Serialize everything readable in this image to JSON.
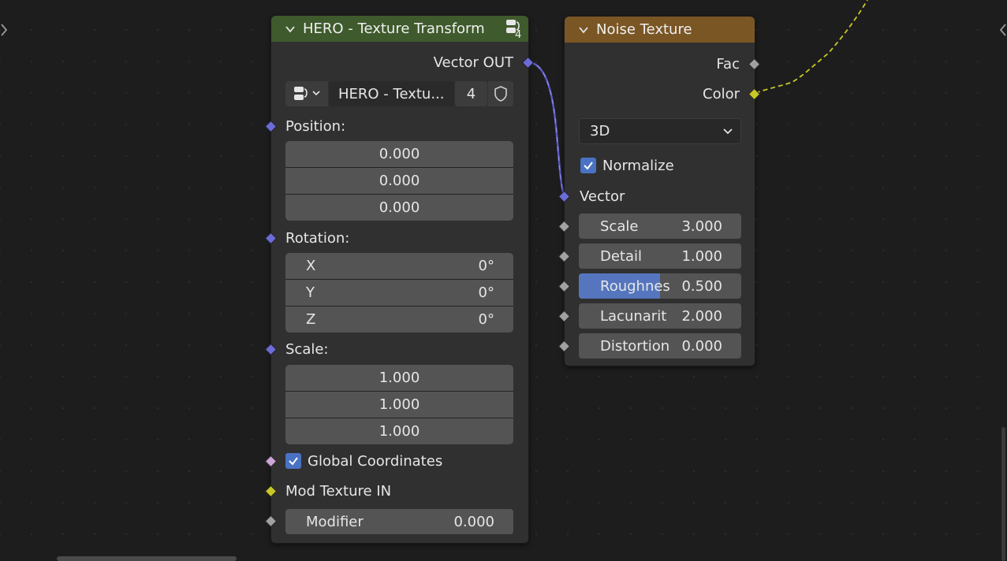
{
  "colors": {
    "header_transform": "#3f5a2c",
    "header_noise": "#7a5625",
    "socket_vector": "#6c6cd6",
    "socket_color": "#c7c729",
    "socket_float": "#a1a1a1",
    "socket_bool": "#cca6d6",
    "checkbox": "#4a72c4"
  },
  "group_node": {
    "title": "HERO - Texture Transform",
    "user_count": "4",
    "output_label": "Vector OUT",
    "datablock": {
      "name": "HERO - Textu...",
      "users": "4"
    },
    "position": {
      "label": "Position:",
      "values": [
        "0.000",
        "0.000",
        "0.000"
      ]
    },
    "rotation": {
      "label": "Rotation:",
      "axes": [
        {
          "axis": "X",
          "value": "0°"
        },
        {
          "axis": "Y",
          "value": "0°"
        },
        {
          "axis": "Z",
          "value": "0°"
        }
      ]
    },
    "scale": {
      "label": "Scale:",
      "values": [
        "1.000",
        "1.000",
        "1.000"
      ]
    },
    "global_coords": {
      "label": "Global Coordinates",
      "checked": true
    },
    "mod_texture": {
      "label": "Mod Texture IN"
    },
    "modifier": {
      "label": "Modifier",
      "value": "0.000"
    }
  },
  "noise_node": {
    "title": "Noise Texture",
    "outputs": {
      "fac": "Fac",
      "color": "Color"
    },
    "dimensions": "3D",
    "normalize": {
      "label": "Normalize",
      "checked": true
    },
    "vector_label": "Vector",
    "fields": [
      {
        "label": "Scale",
        "value": "3.000"
      },
      {
        "label": "Detail",
        "value": "1.000"
      },
      {
        "label": "Roughnes",
        "value": "0.500",
        "fill": 0.5
      },
      {
        "label": "Lacunarit",
        "value": "2.000"
      },
      {
        "label": "Distortion",
        "value": "0.000"
      }
    ]
  }
}
